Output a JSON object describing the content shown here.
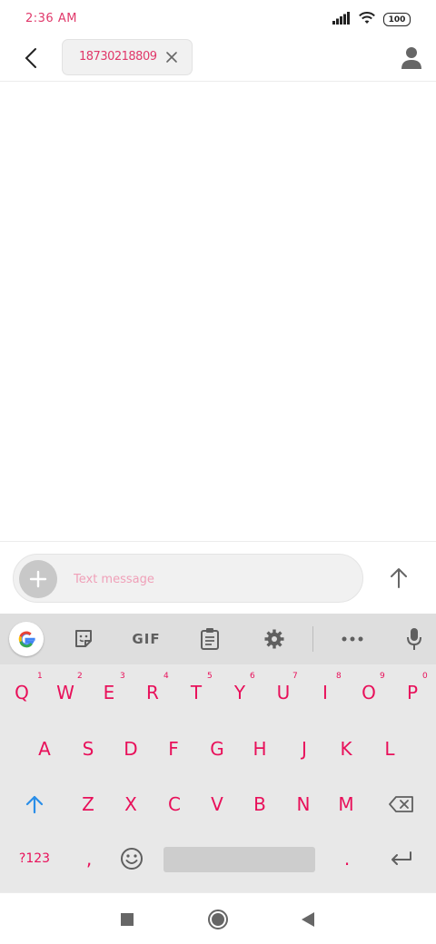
{
  "status_bar": {
    "time": "2:36 AM",
    "battery": "100"
  },
  "header": {
    "recipient": "18730218809"
  },
  "compose": {
    "placeholder": "Text message"
  },
  "keyboard": {
    "toolbar": {
      "gif_label": "GIF"
    },
    "row1": [
      {
        "label": "Q",
        "hint": "1"
      },
      {
        "label": "W",
        "hint": "2"
      },
      {
        "label": "E",
        "hint": "3"
      },
      {
        "label": "R",
        "hint": "4"
      },
      {
        "label": "T",
        "hint": "5"
      },
      {
        "label": "Y",
        "hint": "6"
      },
      {
        "label": "U",
        "hint": "7"
      },
      {
        "label": "I",
        "hint": "8"
      },
      {
        "label": "O",
        "hint": "9"
      },
      {
        "label": "P",
        "hint": "0"
      }
    ],
    "row2": [
      "A",
      "S",
      "D",
      "F",
      "G",
      "H",
      "J",
      "K",
      "L"
    ],
    "row3": [
      "Z",
      "X",
      "C",
      "V",
      "B",
      "N",
      "M"
    ],
    "row4": {
      "symbols_label": "?123",
      "comma": ",",
      "period": "."
    }
  },
  "colors": {
    "accent": "#e8105a",
    "time": "#e0386a",
    "key_bg": "#e8e8e8",
    "toolbar_bg": "#dedede"
  }
}
